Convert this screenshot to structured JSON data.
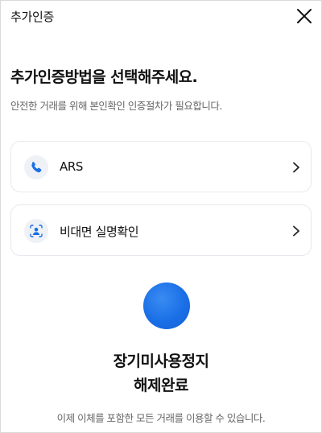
{
  "header": {
    "title": "추가인증",
    "close_icon": "close-icon"
  },
  "main": {
    "heading": "추가인증방법을 선택해주세요.",
    "subtext": "안전한 거래를 위해 본인확인 인증절차가 필요합니다.",
    "options": [
      {
        "label": "ARS",
        "icon": "phone-icon"
      },
      {
        "label": "비대면 실명확인",
        "icon": "face-id-icon"
      }
    ]
  },
  "result": {
    "title_line1": "장기미사용정지",
    "title_line2": "해제완료",
    "description": "이제 이체를 포함한 모든 거래를 이용할 수 있습니다."
  },
  "colors": {
    "accent": "#1a6fe6",
    "icon_bg": "#eef1f6",
    "border": "#e6e9ee",
    "muted_text": "#666666"
  }
}
